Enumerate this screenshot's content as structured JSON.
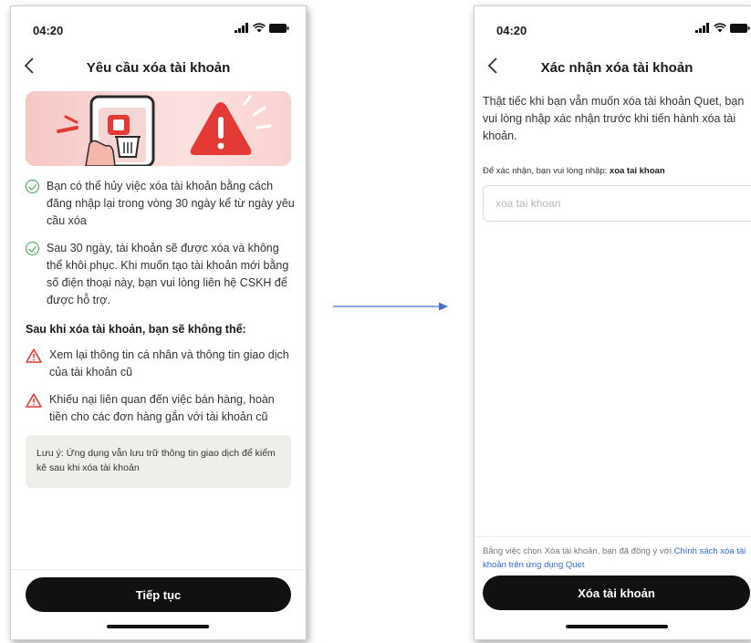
{
  "screen1": {
    "status_time": "04:20",
    "title": "Yêu cầu xóa tài khoản",
    "info_items": [
      {
        "text": "Bạn có thể hủy việc xóa tài khoản bằng cách đăng nhập lại trong vòng 30 ngày kể từ ngày yêu cầu xóa"
      },
      {
        "text": "Sau 30 ngày, tài khoản sẽ được xóa và không thể khôi phục. Khi muốn tạo tài khoản mới bằng số điện thoại này, bạn vui lòng liên hệ CSKH để được hỗ trợ."
      }
    ],
    "section_heading": "Sau khi xóa tài khoản, bạn sẽ không thể:",
    "warning_items": [
      {
        "text": "Xem lại thông tin cá nhân và thông tin giao dịch của tài khoản cũ"
      },
      {
        "text": "Khiếu nại liên quan đến việc bán hàng, hoàn tiền cho các đơn hàng gắn với tài khoản cũ"
      }
    ],
    "note": "Lưu ý: Ứng dụng vẫn lưu trữ thông tin giao dịch để kiểm kê sau khi xóa tài khoản",
    "continue_button": "Tiếp tục"
  },
  "screen2": {
    "status_time": "04:20",
    "title": "Xác nhận xóa tài khoản",
    "intro": "Thật tiếc khi bạn vẫn muốn xóa tài khoản Quet, bạn vui lòng nhập xác nhận trước khi tiến hành xóa tài khoản.",
    "instruction_prefix": "Để xác nhận, bạn vui lòng nhập:",
    "confirm_phrase": "xoa tai khoan",
    "input_placeholder": "xoa tai khoan",
    "consent_prefix": "Bằng việc chọn Xóa tài khoản, bạn đã đồng ý với",
    "consent_link": "Chính sách xóa tài khoản trên ứng dụng Quet",
    "delete_button": "Xóa tài khoản"
  },
  "colors": {
    "check_green": "#2ea44f",
    "warning_red": "#e53935",
    "link_blue": "#2d6cdf",
    "button_black": "#111111",
    "arrow_blue": "#4472c4"
  }
}
